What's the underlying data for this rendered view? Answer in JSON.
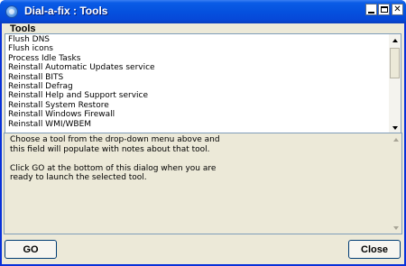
{
  "window": {
    "title": "Dial-a-fix : Tools",
    "icon": "app-icon",
    "controls": [
      "minimize-icon",
      "maximize-icon",
      "close-icon"
    ],
    "close_glyph": "✕"
  },
  "tools_group": {
    "label": "Tools",
    "items": [
      "Flush DNS",
      "Flush icons",
      "Process Idle Tasks",
      "Reinstall Automatic Updates service",
      "Reinstall BITS",
      "Reinstall Defrag",
      "Reinstall Help and Support service",
      "Reinstall System Restore",
      "Reinstall Windows Firewall",
      "Reinstall WMI/WBEM"
    ]
  },
  "notes": {
    "lines": [
      "Choose a tool from the drop-down menu above and",
      "this field will populate with notes about that tool.",
      "",
      "Click GO at the bottom of this dialog when you are",
      "ready to launch the selected tool."
    ]
  },
  "buttons": {
    "go_label": "GO",
    "close_label": "Close"
  },
  "colors": {
    "titlebar": "#0551de",
    "dialog_bg": "#ece9d8",
    "border": "#7f9db9"
  }
}
